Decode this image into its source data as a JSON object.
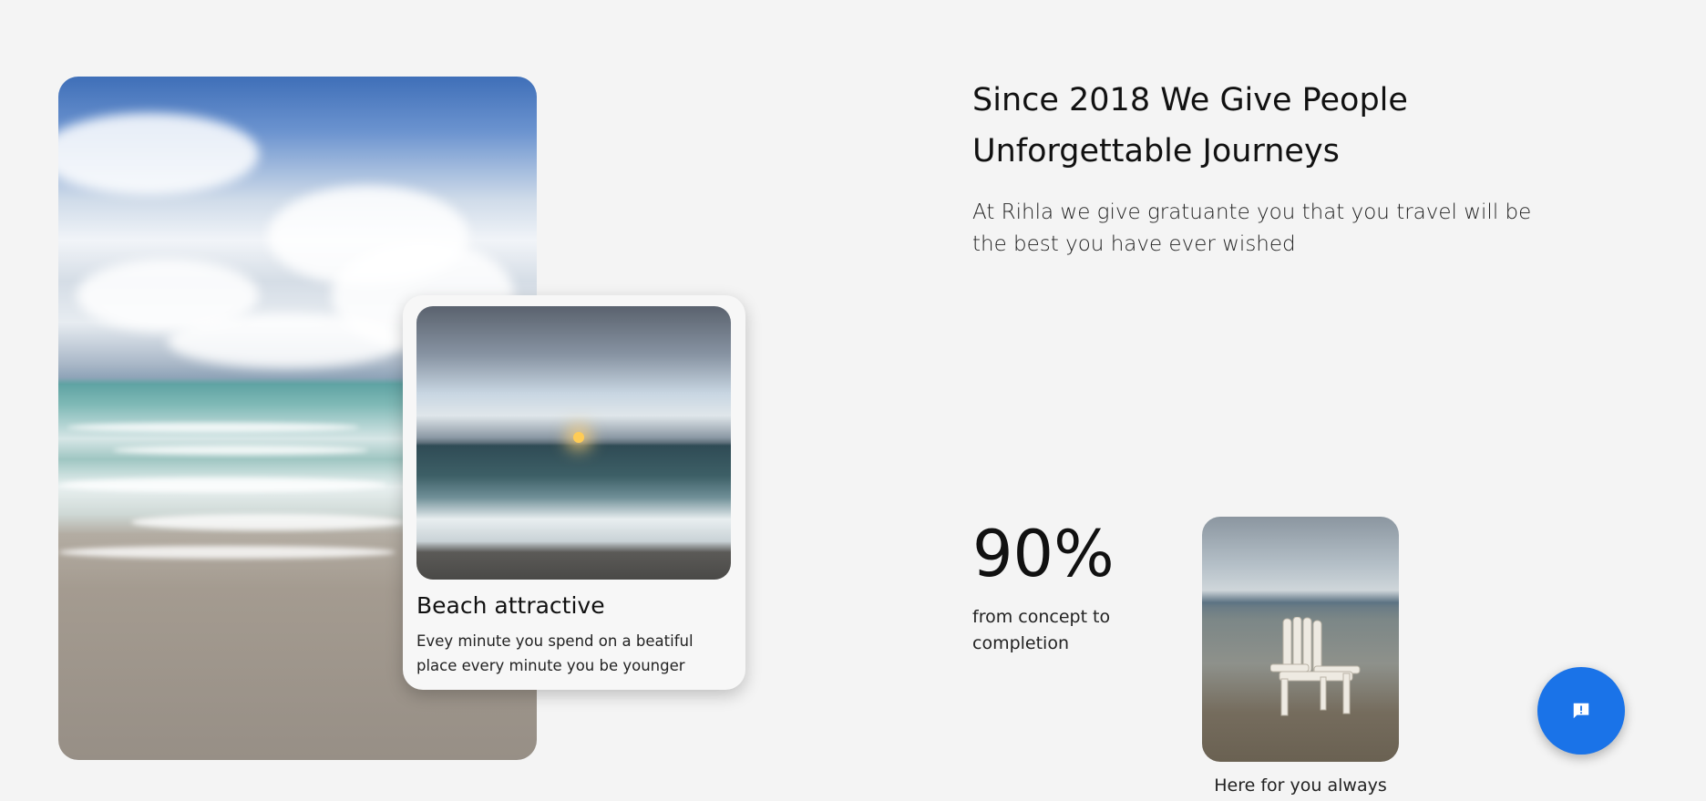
{
  "feature_card": {
    "title": "Beach attractive",
    "text": "Evey minute you spend on a beatiful place every minute you be younger"
  },
  "intro": {
    "headline": "Since 2018 We Give People Unforgettable Journeys",
    "subtext": "At Rihla we give gratuante you that you travel will be the best you have ever wished"
  },
  "stat": {
    "value": "90%",
    "label": "from concept to completion"
  },
  "chair_caption": "Here for you always",
  "icons": {
    "chat_fab": "feedback-chat-icon"
  },
  "colors": {
    "background": "#f4f4f4",
    "fab": "#1a73e8"
  }
}
